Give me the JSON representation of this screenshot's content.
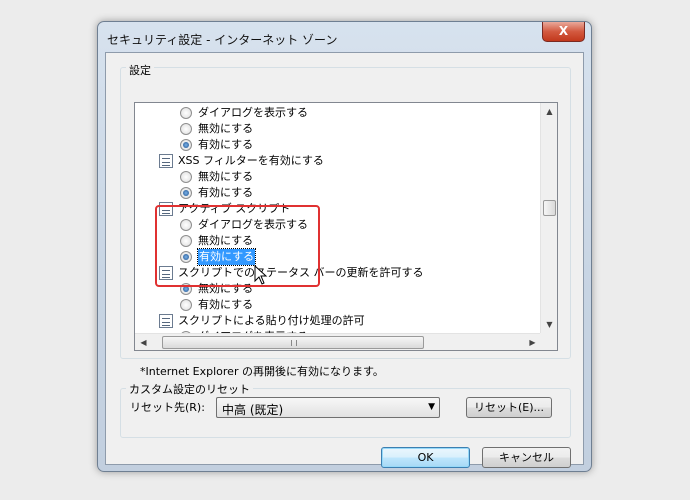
{
  "window": {
    "title": "セキュリティ設定 - インターネット ゾーン",
    "close_label": "X"
  },
  "settings_group": {
    "label": "設定",
    "rows": [
      {
        "type": "radio",
        "label": "ダイアログを表示する",
        "checked": false
      },
      {
        "type": "radio",
        "label": "無効にする",
        "checked": false
      },
      {
        "type": "radio",
        "label": "有効にする",
        "checked": true
      },
      {
        "type": "category",
        "label": "XSS フィルターを有効にする"
      },
      {
        "type": "radio",
        "label": "無効にする",
        "checked": false
      },
      {
        "type": "radio",
        "label": "有効にする",
        "checked": true
      },
      {
        "type": "category",
        "label": "アクティブ スクリプト"
      },
      {
        "type": "radio",
        "label": "ダイアログを表示する",
        "checked": false
      },
      {
        "type": "radio",
        "label": "無効にする",
        "checked": false
      },
      {
        "type": "radio",
        "label": "有効にする",
        "checked": true,
        "selected": true
      },
      {
        "type": "category",
        "label": "スクリプトでのステータス バーの更新を許可する"
      },
      {
        "type": "radio",
        "label": "無効にする",
        "checked": true
      },
      {
        "type": "radio",
        "label": "有効にする",
        "checked": false
      },
      {
        "type": "category",
        "label": "スクリプトによる貼り付け処理の許可"
      },
      {
        "type": "radio",
        "label": "ダイアログを表示する",
        "checked": false
      }
    ],
    "note": "*Internet Explorer の再開後に有効になります。"
  },
  "reset_group": {
    "label": "カスタム設定のリセット",
    "reset_to_label": "リセット先(R):",
    "dropdown_value": "中高 (既定)",
    "reset_button": "リセット(E)..."
  },
  "buttons": {
    "ok": "OK",
    "cancel": "キャンセル"
  },
  "colors": {
    "highlight_box": "#e03131",
    "selection": "#3399ff"
  }
}
